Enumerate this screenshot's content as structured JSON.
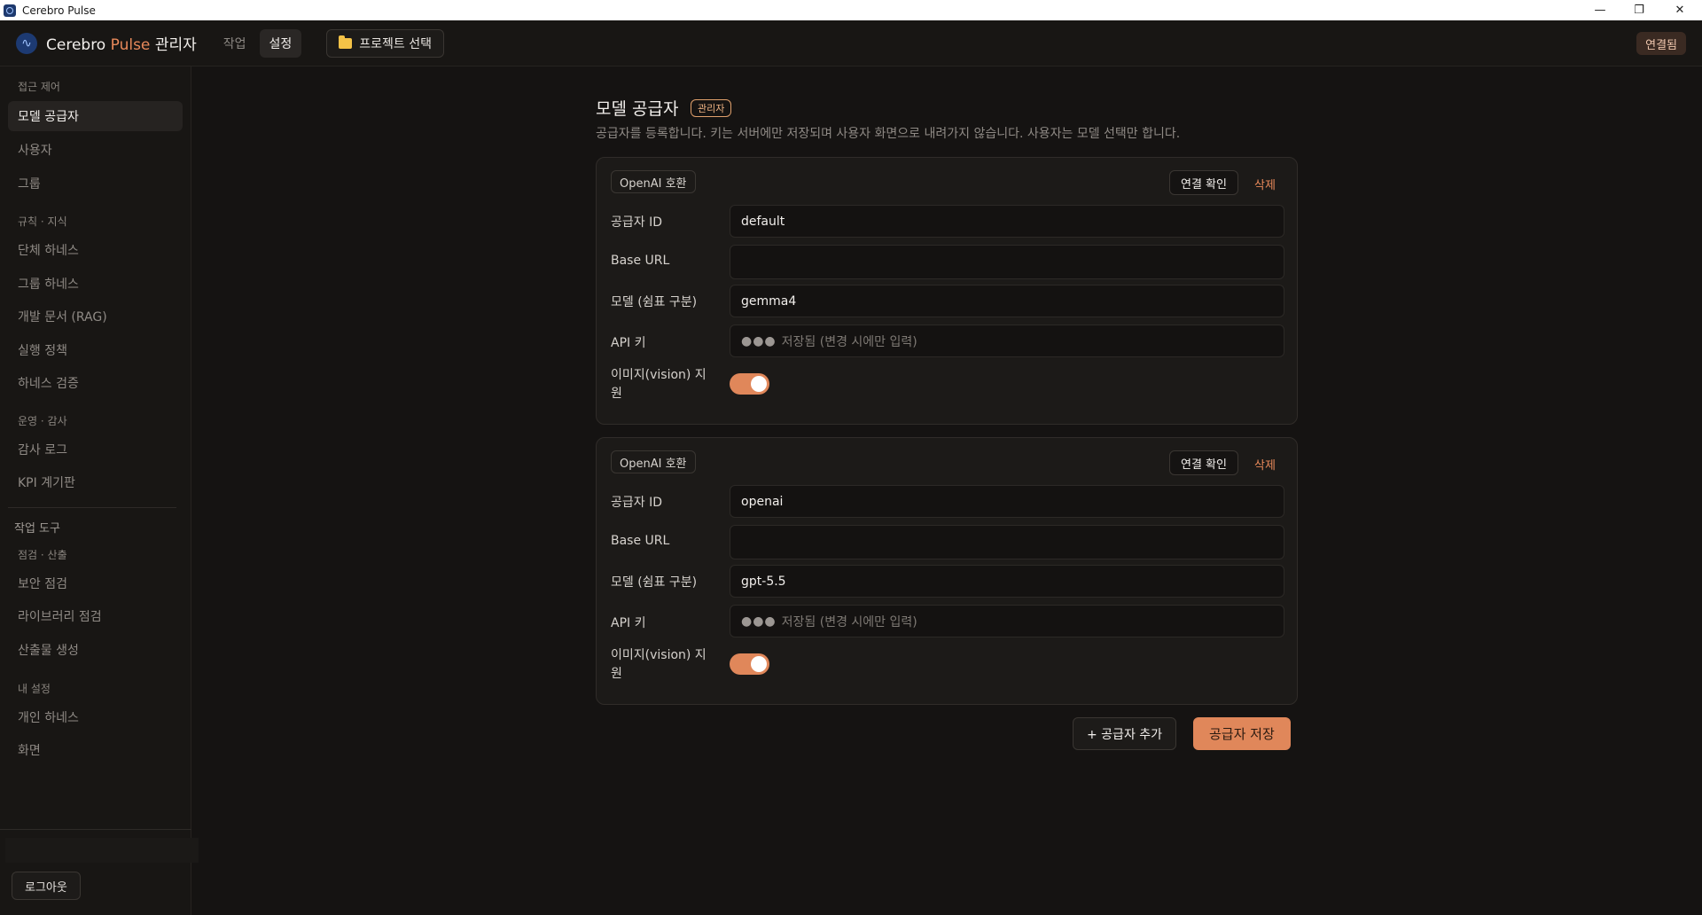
{
  "window": {
    "title": "Cerebro Pulse",
    "minimize_icon": "minimize-icon",
    "maximize_icon": "restore-icon",
    "close_icon": "close-icon"
  },
  "header": {
    "brand_main": "Cerebro",
    "brand_accent": "Pulse",
    "brand_suffix": "관리자",
    "tabs": [
      {
        "label": "작업",
        "active": false
      },
      {
        "label": "설정",
        "active": true
      }
    ],
    "project_button": "프로젝트 선택",
    "status": "연결됨"
  },
  "sidebar": {
    "sections": [
      {
        "title": "접근 제어",
        "items": [
          "모델 공급자",
          "사용자",
          "그룹"
        ]
      },
      {
        "title": "규칙 · 지식",
        "items": [
          "단체 하네스",
          "그룹 하네스",
          "개발 문서 (RAG)",
          "실행 정책",
          "하네스 검증"
        ]
      },
      {
        "title": "운영 · 감사",
        "items": [
          "감사 로그",
          "KPI 계기판"
        ]
      },
      {
        "title": "작업 도구",
        "items": []
      },
      {
        "title": "점검 · 산출",
        "items": [
          "보안 점검",
          "라이브러리 점검",
          "산출물 생성"
        ]
      },
      {
        "title": "내 설정",
        "items": [
          "개인 하네스",
          "화면"
        ]
      }
    ],
    "active_item": "모델 공급자",
    "logout": "로그아웃"
  },
  "main": {
    "title": "모델 공급자",
    "badge": "관리자",
    "description": "공급자를 등록합니다. 키는 서버에만 저장되며 사용자 화면으로 내려가지 않습니다. 사용자는 모델 선택만 합니다.",
    "labels": {
      "provider_id": "공급자 ID",
      "base_url": "Base URL",
      "model": "모델 (쉼표 구분)",
      "api_key": "API 키",
      "vision": "이미지(vision) 지원"
    },
    "providers": [
      {
        "type": "OpenAI 호환",
        "check_button": "연결 확인",
        "delete_button": "삭제",
        "provider_id": "default",
        "base_url": "",
        "model": "gemma4",
        "api_key_dots": "●●●",
        "api_key_placeholder": "저장됨 (변경 시에만 입력)",
        "vision": true
      },
      {
        "type": "OpenAI 호환",
        "check_button": "연결 확인",
        "delete_button": "삭제",
        "provider_id": "openai",
        "base_url": "",
        "model": "gpt-5.5",
        "api_key_dots": "●●●",
        "api_key_placeholder": "저장됨 (변경 시에만 입력)",
        "vision": true
      }
    ],
    "add_button": "+ 공급자 추가",
    "save_button": "공급자 저장"
  },
  "colors": {
    "accent": "#e0875a",
    "background": "#151312"
  }
}
